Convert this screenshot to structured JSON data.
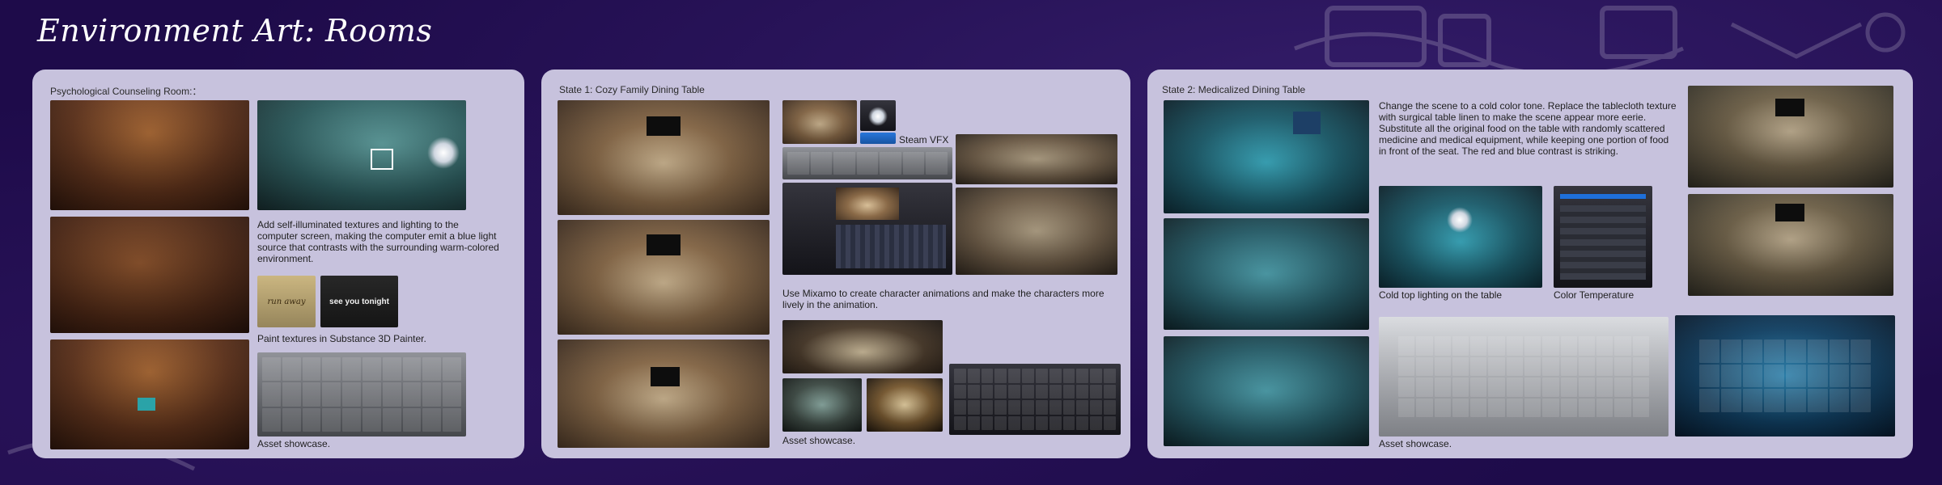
{
  "page": {
    "title": "Environment Art: Rooms"
  },
  "panel1": {
    "title": "Psychological Counseling Room:：",
    "caption_light": "Add self-illuminated textures and lighting to the computer screen, making the computer emit a blue light source that contrasts with the surrounding warm-colored environment.",
    "note1_text": "run away",
    "note2_text": "see you tonight",
    "caption_paint": "Paint textures in Substance 3D Painter.",
    "caption_assets": "Asset showcase."
  },
  "panel2": {
    "title": "State 1: Cozy Family Dining Table",
    "caption_vfx": "Steam VFX",
    "caption_mixamo": "Use Mixamo to create character animations and make the characters more lively in the animation.",
    "caption_assets": "Asset showcase."
  },
  "panel3": {
    "title": "State 2: Medicalized Dining Table",
    "description": "Change the scene to a cold color tone. Replace the tablecloth texture with surgical table linen to make the scene appear more eerie. Substitute all the original food on the table with randomly scattered medicine and medical equipment, while keeping one portion of food in front of the seat. The red and blue contrast is striking.",
    "caption_lighting": "Cold top lighting on the table",
    "caption_color_temp": "Color Temperature",
    "caption_assets": "Asset showcase."
  },
  "colors": {
    "background": "#1e0b4a",
    "panel": "#c7c2dd",
    "accent_blue": "#1e6fd9"
  }
}
